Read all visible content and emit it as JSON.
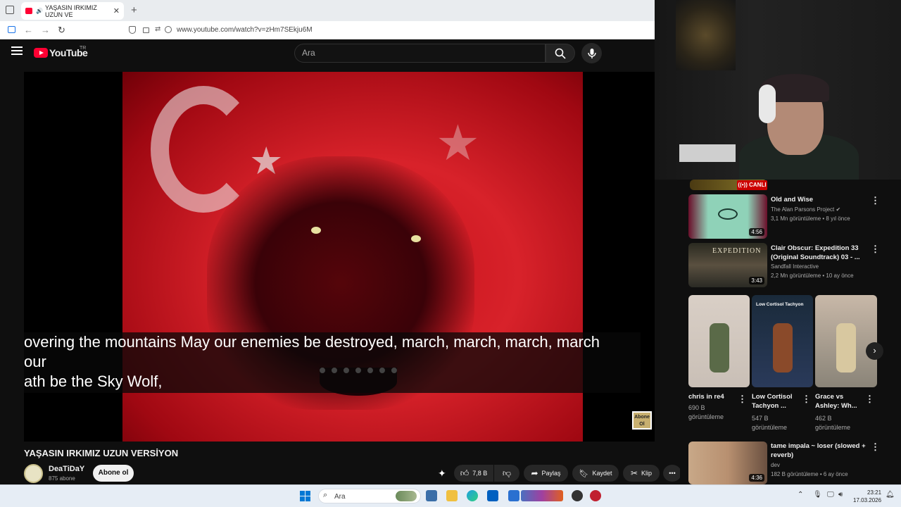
{
  "browser": {
    "tab_title": "YAŞASIN IRKIMIZ UZUN VE",
    "tab_close": "✕",
    "new_tab": "+",
    "url": "www.youtube.com/watch?v=zHm7SEkju6M"
  },
  "youtube": {
    "logo_text": "YouTube",
    "region": "TR",
    "search_placeholder": "Ara"
  },
  "player": {
    "captions": [
      "overing the mountains May our enemies be destroyed, march, march, march, march",
      "our",
      "ath be the Sky Wolf,"
    ],
    "watermark": "Abone Ol"
  },
  "video": {
    "title": "YAŞASIN IRKIMIZ UZUN VERSİYON",
    "channel": "DeaTiDaY",
    "subscribers": "875 abone",
    "subscribe_label": "Abone ol",
    "likes": "7,8 B",
    "share_label": "Paylaş",
    "save_label": "Kaydet",
    "clip_label": "Klip",
    "more": "•••"
  },
  "sidebar": {
    "live_badge": "CANLI",
    "items": [
      {
        "title": "Old and Wise",
        "channel": "The Alan Parsons Project",
        "meta": "3,1 Mn görüntüleme • 8 yıl önce",
        "duration": "4:56"
      },
      {
        "title": "Clair Obscur: Expedition 33 (Original Soundtrack) 03 - ...",
        "channel": "Sandfall Interactive",
        "meta": "2,2 Mn görüntüleme • 10 ay önce",
        "duration": "3:43"
      },
      {
        "title": "tame impala ~ loser (slowed + reverb)",
        "channel": "dev",
        "meta": "182 B görüntüleme • 6 ay önce",
        "duration": "4:36"
      }
    ],
    "shorts": [
      {
        "title": "chris in re4",
        "views": "690 B",
        "views_label": "görüntüleme"
      },
      {
        "title": "Low Cortisol Tachyon ...",
        "views": "547 B",
        "views_label": "görüntüleme"
      },
      {
        "title": "Grace vs Ashley: Wh...",
        "views": "462 B",
        "views_label": "görüntüleme"
      }
    ],
    "shorts_thumb_text": "Low Cortisol Tachyon",
    "next_arrow": "›"
  },
  "taskbar": {
    "search_placeholder": "Ara",
    "time": "23:21",
    "date": "17.03.2026"
  },
  "colors": {
    "yt_red": "#ff0033",
    "dark_bg": "#0f0f0f",
    "taskbar": "#e6edf5"
  }
}
